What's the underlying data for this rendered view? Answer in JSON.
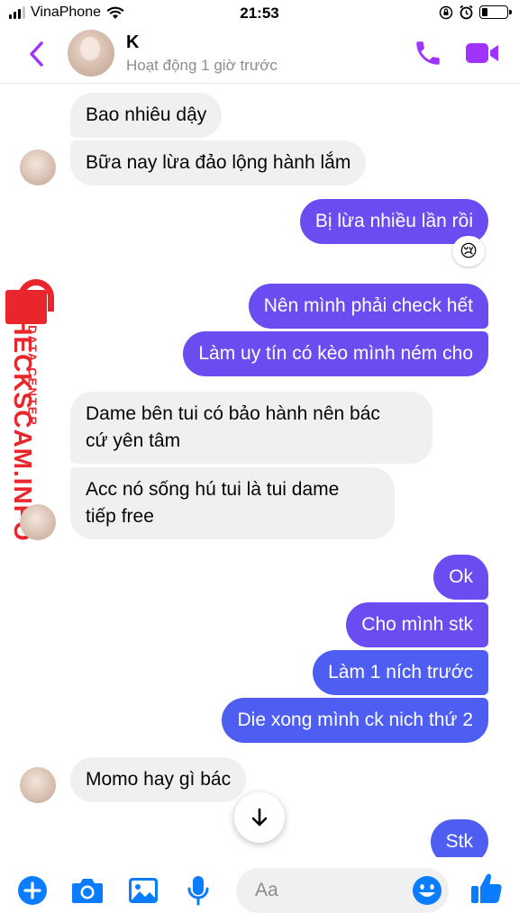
{
  "status_bar": {
    "carrier": "VinaPhone",
    "time": "21:53",
    "icons": [
      "signal-icon",
      "wifi-icon",
      "orientation-lock-icon",
      "alarm-icon",
      "battery-icon"
    ]
  },
  "header": {
    "name": "K",
    "status": "Hoạt động 1 giờ trước",
    "accent_color": "#a033ff"
  },
  "messages": [
    {
      "side": "in",
      "text": "Bao nhiêu dậy"
    },
    {
      "side": "in",
      "text": "Bữa nay lừa đảo lộng hành lắm"
    },
    {
      "side": "out",
      "text": "Bị lừa nhiều lần rồi",
      "reaction": "😢"
    },
    {
      "side": "out",
      "text": "Nên mình phải check hết"
    },
    {
      "side": "out",
      "text": "Làm uy tín có kèo mình ném cho"
    },
    {
      "side": "in",
      "line1": "Dame bên tui có bảo hành nên bác",
      "line2": "cứ yên tâm"
    },
    {
      "side": "in",
      "line1": "Acc nó sống hú tui là tui dame",
      "line2": "tiếp free"
    },
    {
      "side": "out",
      "text": "Ok"
    },
    {
      "side": "out",
      "text": "Cho mình stk"
    },
    {
      "side": "out",
      "text": "Làm 1 ních trước"
    },
    {
      "side": "out",
      "text": "Die xong mình ck nich thứ 2"
    },
    {
      "side": "in",
      "text": "Momo hay gì bác"
    },
    {
      "side": "out",
      "text": "Stk"
    }
  ],
  "watermark": {
    "main": "CHECKSCAM.INFO",
    "sub": "DATA CENTER",
    "color": "#e8262b"
  },
  "composer": {
    "placeholder": "Aa",
    "icons": [
      "plus-icon",
      "camera-icon",
      "image-icon",
      "microphone-icon",
      "emoji-icon",
      "like-icon"
    ],
    "accent_color": "#0a7cff"
  },
  "colors": {
    "outgoing_purple": "#6a4cf0",
    "outgoing_blue": "#4e5ef2",
    "incoming": "#f0f0f0"
  }
}
